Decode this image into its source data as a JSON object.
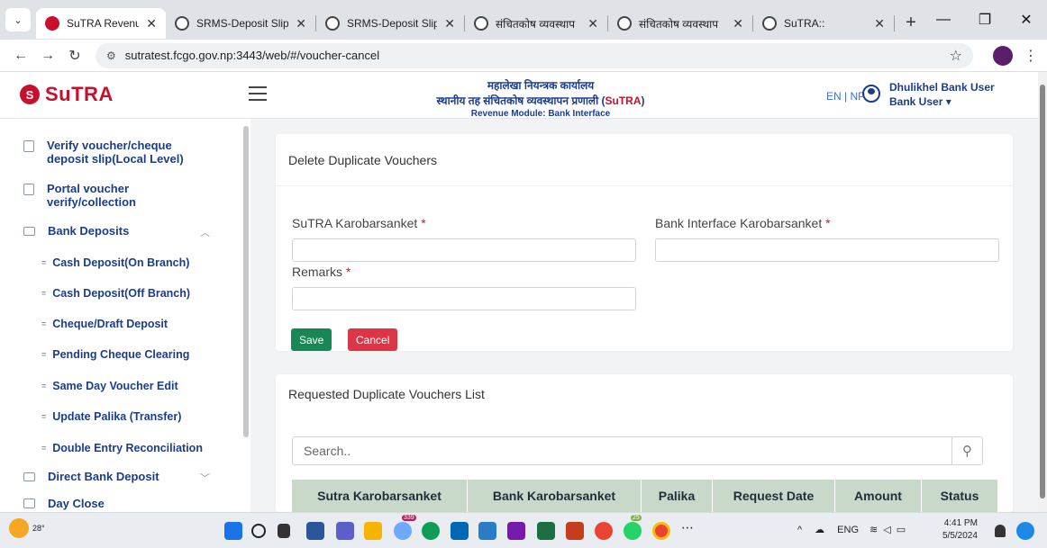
{
  "browser": {
    "tabs": [
      {
        "title": "SuTRA Revenue M",
        "active": true,
        "icon": "sutra"
      },
      {
        "title": "SRMS-Deposit Slip",
        "active": false,
        "icon": "globe"
      },
      {
        "title": "SRMS-Deposit Slip",
        "active": false,
        "icon": "globe"
      },
      {
        "title": "संचितकोष व्यवस्थाप",
        "active": false,
        "icon": "globe"
      },
      {
        "title": "संचितकोष व्यवस्थाप",
        "active": false,
        "icon": "globe"
      },
      {
        "title": "SuTRA::",
        "active": false,
        "icon": "globe"
      }
    ],
    "url": "sutratest.fcgo.gov.np:3443/web/#/voucher-cancel"
  },
  "header": {
    "logo_text": "SuTRA",
    "office_line": "महालेखा नियन्त्रक कार्यालय",
    "system_line": "स्थानीय तह संचितकोष व्यवस्थापन प्रणाली (",
    "system_accent": "SuTRA",
    "system_close": ")",
    "module_line": "Revenue Module: Bank Interface",
    "lang_toggle": "EN | NP",
    "user_name": "Dhulikhel Bank User",
    "user_role": "Bank User ▾"
  },
  "sidebar": {
    "items": [
      {
        "label_1": "Verify voucher/cheque",
        "label_2": "deposit slip(Local Level)"
      },
      {
        "label_1": "Portal voucher",
        "label_2": "verify/collection"
      },
      {
        "label": "Bank Deposits"
      },
      {
        "label": "Direct Bank Deposit"
      },
      {
        "label": "Day Close"
      }
    ],
    "sub_items": [
      "Cash Deposit(On Branch)",
      "Cash Deposit(Off Branch)",
      "Cheque/Draft Deposit",
      "Pending Cheque Clearing",
      "Same Day Voucher Edit",
      "Update Palika (Transfer)",
      "Double Entry Reconciliation"
    ]
  },
  "form": {
    "title": "Delete Duplicate Vouchers",
    "sutra_label": "SuTRA Karobarsanket",
    "bank_label": "Bank Interface Karobarsanket",
    "remarks_label": "Remarks",
    "required_mark": "*",
    "sutra_value": "",
    "bank_value": "",
    "remarks_value": "",
    "save_label": "Save",
    "cancel_label": "Cancel"
  },
  "list": {
    "title": "Requested Duplicate Vouchers List",
    "search_placeholder": "Search..",
    "columns": [
      "Sutra Karobarsanket",
      "Bank Karobarsanket",
      "Palika",
      "Request Date",
      "Amount",
      "Status"
    ]
  },
  "taskbar": {
    "weather": "28°",
    "lang": "ENG",
    "time": "4:41 PM",
    "date": "5/5/2024",
    "badge_1": "339",
    "badge_2": "25"
  },
  "colors": {
    "brand_red": "#c8102e",
    "nav_blue": "#1a3d8f",
    "save_green": "#198754",
    "cancel_red": "#dc3545",
    "table_header": "#c9d9c9"
  }
}
